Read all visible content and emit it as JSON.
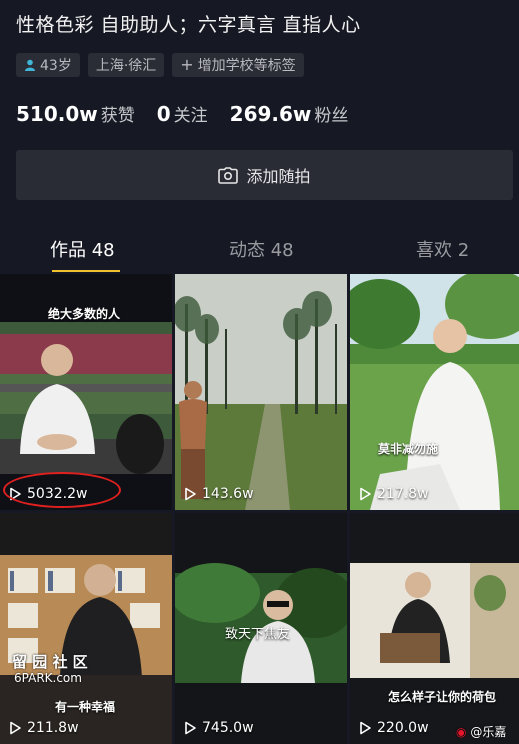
{
  "profile": {
    "bio": "性格色彩 自助助人；六字真言 直指人心",
    "tags": {
      "age": "43岁",
      "location": "上海·徐汇",
      "add_school": "增加学校等标签"
    },
    "stats": [
      {
        "value": "510.0w",
        "label": "获赞"
      },
      {
        "value": "0",
        "label": "关注"
      },
      {
        "value": "269.6w",
        "label": "粉丝"
      }
    ],
    "add_photo_label": "添加随拍"
  },
  "tabs": [
    {
      "label": "作品 48",
      "active": true
    },
    {
      "label": "动态 48",
      "active": false
    },
    {
      "label": "喜欢 2",
      "active": false
    }
  ],
  "videos": [
    {
      "plays": "5032.2w",
      "caption": "绝大多数的人",
      "highlighted": true
    },
    {
      "plays": "143.6w"
    },
    {
      "plays": "217.8w",
      "caption": "莫非减勿施"
    },
    {
      "plays": "211.8w",
      "caption": "有一种幸福"
    },
    {
      "plays": "745.0w",
      "caption": "致天下焦友"
    },
    {
      "plays": "220.0w",
      "caption": "怎么样子让你的荷包"
    }
  ],
  "watermarks": {
    "site_cn": "留 园 社 区",
    "site_en": "6PARK.com",
    "weibo": "@乐嘉"
  },
  "colors": {
    "background": "#161823",
    "accent": "#f2c12e",
    "highlight_ring": "#e0201f"
  }
}
